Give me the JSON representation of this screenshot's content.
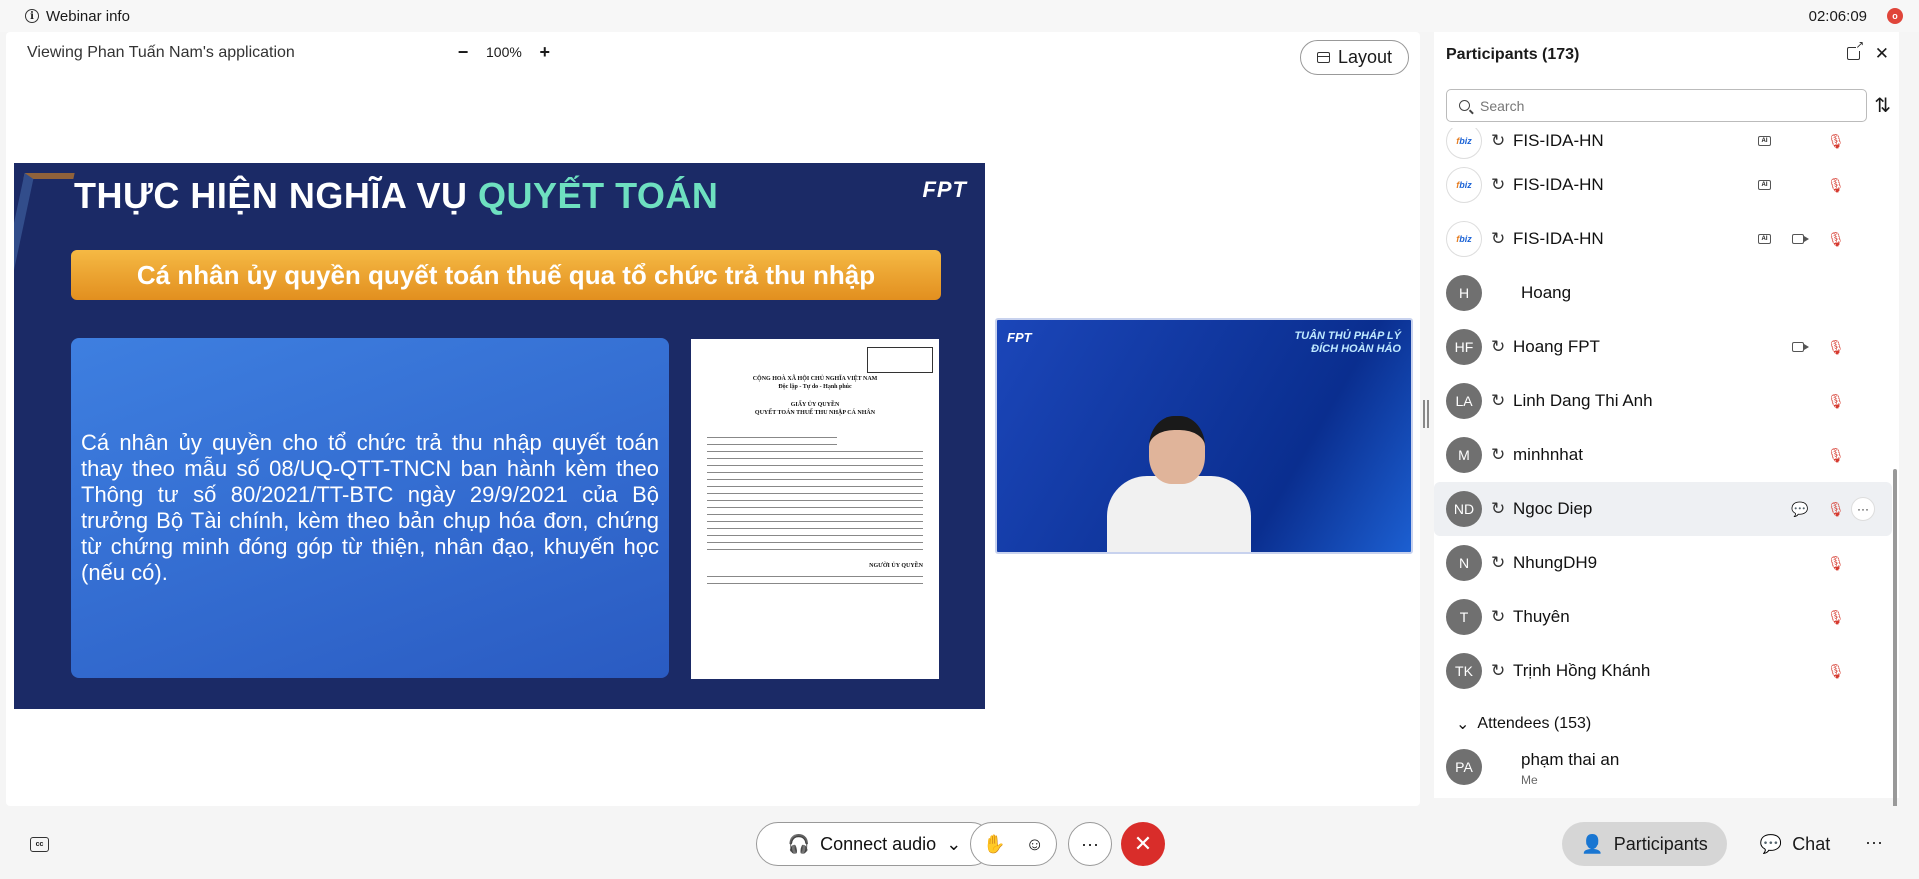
{
  "topbar": {
    "title": "Webinar info",
    "timer": "02:06:09",
    "rec_badge": "o"
  },
  "stage": {
    "viewing_text": "Viewing Phan Tuấn Nam's application",
    "zoom": {
      "minus": "−",
      "level": "100%",
      "plus": "+"
    },
    "layout_label": "Layout"
  },
  "slide": {
    "title_part1": "THỰC HIỆN NGHĨA VỤ ",
    "title_part2": "QUYẾT TOÁN",
    "logo": "FPT",
    "banner": "Cá nhân ủy quyền quyết toán thuế qua tổ chức trả thu nhập",
    "body": "Cá nhân ủy quyền cho tổ chức trả thu nhập quyết toán thay theo mẫu số 08/UQ-QTT-TNCN ban hành kèm theo Thông tư số 80/2021/TT-BTC ngày 29/9/2021 của Bộ trưởng Bộ Tài chính, kèm theo bản chụp hóa đơn, chứng từ chứng minh đóng góp từ thiện, nhân đạo, khuyến học (nếu có).",
    "doc": {
      "line1": "CỘNG HOÀ XÃ HỘI CHỦ NGHĨA VIỆT NAM",
      "line2": "Độc lập - Tự do - Hạnh phúc",
      "line3": "GIẤY ỦY QUYỀN",
      "line4": "QUYẾT TOÁN THUẾ THU NHẬP CÁ NHÂN",
      "sign": "NGƯỜI ỦY QUYỀN"
    }
  },
  "video": {
    "logo": "FPT",
    "caption_line1": "TUÂN THỦ PHÁP LÝ",
    "caption_line2": "ĐÍCH HOÀN HẢO"
  },
  "panel": {
    "title": "Participants (173)",
    "search_placeholder": "Search",
    "participants": [
      {
        "initials": "",
        "name": "FIS-IDA-HN",
        "logo": true,
        "cc": true,
        "cam": false
      },
      {
        "initials": "",
        "name": "FIS-IDA-HN",
        "logo": true,
        "cc": true,
        "cam": false
      },
      {
        "initials": "",
        "name": "FIS-IDA-HN",
        "logo": true,
        "cc": true,
        "cam": true
      },
      {
        "initials": "H",
        "name": "Hoang"
      },
      {
        "initials": "HF",
        "name": "Hoang FPT",
        "cam": true
      },
      {
        "initials": "LA",
        "name": "Linh Dang Thi Anh"
      },
      {
        "initials": "M",
        "name": "minhnhat"
      },
      {
        "initials": "ND",
        "name": "Ngoc Diep"
      },
      {
        "initials": "N",
        "name": "NhungDH9"
      },
      {
        "initials": "T",
        "name": "Thuyên"
      },
      {
        "initials": "TK",
        "name": "Trịnh Hồng Khánh"
      }
    ],
    "attendees_label": "Attendees (153)",
    "me": {
      "initials": "PA",
      "name": "phạm thai an",
      "sub": "Me"
    }
  },
  "bottom": {
    "cc": "cc",
    "connect_audio": "Connect audio",
    "more": "···",
    "participants": "Participants",
    "chat": "Chat",
    "bottom_more": "···"
  },
  "colors": {
    "leave": "#d92d2a",
    "slide_bg": "#1b2a66",
    "banner": "#f0a52c",
    "mic_off": "#d63b30"
  }
}
